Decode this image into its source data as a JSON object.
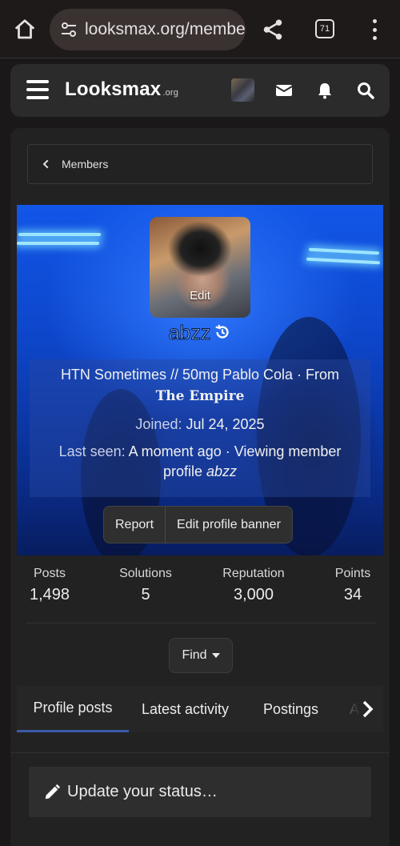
{
  "browser": {
    "url": "looksmax.org/members/",
    "tab_count": "71",
    "icons": [
      "home-icon",
      "tune-icon",
      "share-icon",
      "tabs-icon",
      "more-vert-icon"
    ]
  },
  "site_nav": {
    "logo": "Looksmax",
    "logo_suffix": ".org",
    "icons": [
      "menu-icon",
      "mail-icon",
      "bell-icon",
      "search-icon"
    ]
  },
  "breadcrumb": {
    "label": "Members"
  },
  "profile": {
    "avatar_edit": "Edit",
    "username": "abzz",
    "status_line": "HTN Sometimes // 50mg Pablo Cola · From",
    "status_line2": "The Empire",
    "joined_label": "Joined:",
    "joined_value": "Jul 24, 2025",
    "last_seen_label": "Last seen:",
    "last_seen_value": "A moment ago · Viewing member",
    "last_seen_value2": "profile",
    "last_seen_user": "abzz",
    "report_label": "Report",
    "edit_banner_label": "Edit profile banner"
  },
  "stats": [
    {
      "label": "Posts",
      "value": "1,498"
    },
    {
      "label": "Solutions",
      "value": "5"
    },
    {
      "label": "Reputation",
      "value": "3,000"
    },
    {
      "label": "Points",
      "value": "34"
    }
  ],
  "find_label": "Find",
  "tabs": [
    {
      "label": "Profile posts",
      "active": true
    },
    {
      "label": "Latest activity",
      "active": false
    },
    {
      "label": "Postings",
      "active": false
    },
    {
      "label": "A",
      "active": false
    }
  ],
  "status_prompt": "Update your status…",
  "colors": {
    "accent": "#3b5ba8",
    "username": "#7ab0ff",
    "background": "#1a1818"
  }
}
